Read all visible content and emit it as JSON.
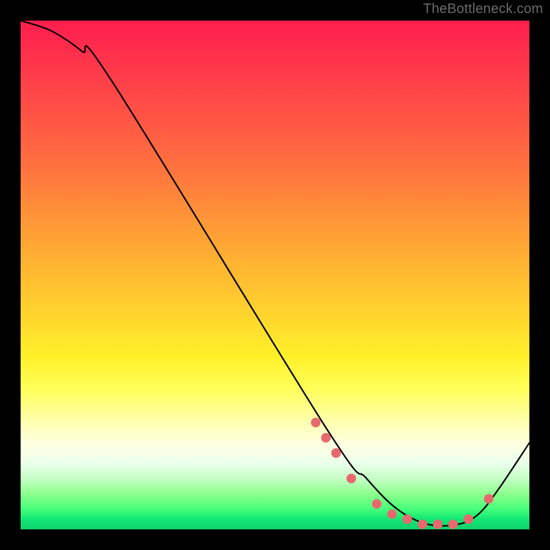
{
  "attribution": "TheBottleneck.com",
  "chart_data": {
    "type": "line",
    "title": "",
    "xlabel": "",
    "ylabel": "",
    "xlim": [
      0,
      100
    ],
    "ylim": [
      0,
      100
    ],
    "series": [
      {
        "name": "bottleneck-curve",
        "x": [
          0,
          6,
          12,
          18,
          60,
          68,
          74,
          80,
          86,
          90,
          94,
          100
        ],
        "y": [
          100,
          98,
          94,
          88,
          20,
          10,
          4,
          1,
          1,
          3,
          8,
          17
        ]
      }
    ],
    "markers": {
      "name": "highlight-points",
      "points": [
        {
          "x": 58,
          "y": 21
        },
        {
          "x": 60,
          "y": 18
        },
        {
          "x": 62,
          "y": 15
        },
        {
          "x": 65,
          "y": 10
        },
        {
          "x": 70,
          "y": 5
        },
        {
          "x": 73,
          "y": 3
        },
        {
          "x": 76,
          "y": 2
        },
        {
          "x": 79,
          "y": 1
        },
        {
          "x": 82,
          "y": 1
        },
        {
          "x": 85,
          "y": 1
        },
        {
          "x": 88,
          "y": 2
        },
        {
          "x": 92,
          "y": 6
        }
      ]
    },
    "gradient_stops": [
      {
        "pos": 0,
        "color": "#ff1e4e"
      },
      {
        "pos": 50,
        "color": "#ffc030"
      },
      {
        "pos": 75,
        "color": "#ffff60"
      },
      {
        "pos": 100,
        "color": "#10d870"
      }
    ]
  }
}
